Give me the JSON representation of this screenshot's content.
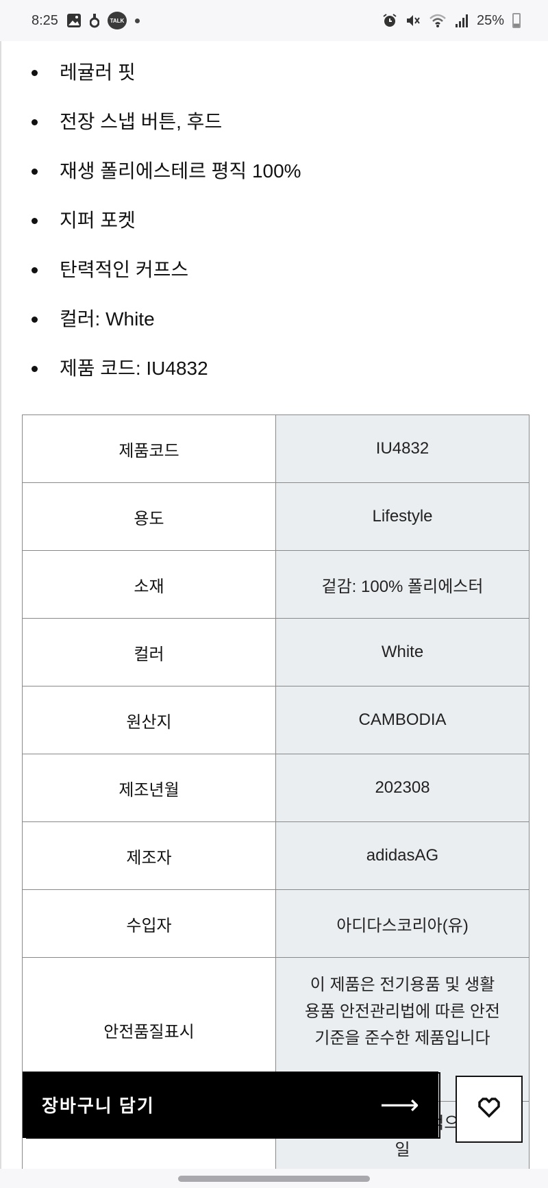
{
  "status_bar": {
    "time": "8:25",
    "left_icons": [
      "gallery-icon",
      "app-notification-icon",
      "kakaotalk-icon",
      "more-notifications-dot"
    ],
    "talk_label": "TALK",
    "right_icons": [
      "alarm-icon",
      "mute-icon",
      "wifi-icon",
      "signal-icon"
    ],
    "battery": "25%"
  },
  "features": [
    "레귤러 핏",
    "전장 스냅 버튼, 후드",
    "재생 폴리에스테르 평직 100%",
    "지퍼 포켓",
    "탄력적인 커프스",
    "컬러: White",
    "제품 코드: IU4832"
  ],
  "spec_table": {
    "rows": [
      {
        "label": "제품코드",
        "value": "IU4832"
      },
      {
        "label": "용도",
        "value": "Lifestyle"
      },
      {
        "label": "소재",
        "value": "겉감: 100% 폴리에스터"
      },
      {
        "label": "컬러",
        "value": "White"
      },
      {
        "label": "원산지",
        "value": "CAMBODIA"
      },
      {
        "label": "제조년월",
        "value": "202308"
      },
      {
        "label": "제조자",
        "value": "adidasAG"
      },
      {
        "label": "수입자",
        "value": "아디다스코리아(유)"
      },
      {
        "label": "안전품질표시",
        "value": "이 제품은 전기용품 및 생활용품 안전관리법에 따른 안전기준을 준수한 제품입니다"
      },
      {
        "label": "",
        "value": "...에 해당 시 예외적으로 동일"
      }
    ]
  },
  "actions": {
    "cart_label": "장바구니 담기",
    "cart_arrow": "⟶",
    "wishlist_icon": "heart-icon"
  },
  "colors": {
    "value_cell_bg": "#ebeef1",
    "border": "#888888",
    "cart_bg": "#000000"
  }
}
